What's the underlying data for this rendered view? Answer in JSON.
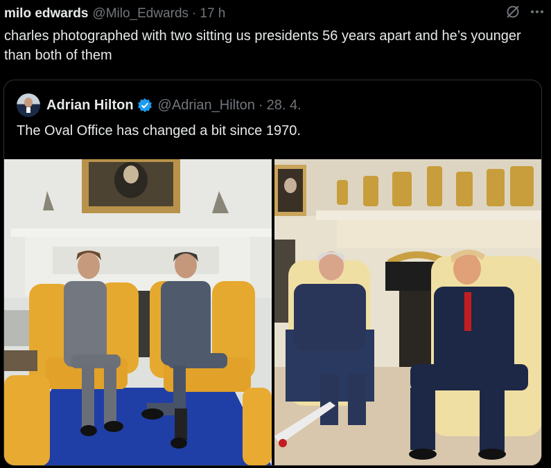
{
  "tweet": {
    "author_name": "milo edwards",
    "author_handle": "@Milo_Edwards",
    "separator": "·",
    "time": "17 h",
    "text": "charles photographed with two sitting us presidents 56 years apart and he’s younger than both of them"
  },
  "quote": {
    "author_name": "Adrian Hilton",
    "author_handle": "@Adrian_Hilton",
    "separator": "·",
    "date": "28. 4.",
    "text": "The Oval Office has changed a bit since 1970."
  },
  "icons": {
    "grok": "grok-icon",
    "more": "more-icon",
    "verified": "verified-badge-icon"
  },
  "colors": {
    "background": "#000000",
    "text": "#e7e9ea",
    "secondary_text": "#71767b",
    "border": "#2f3336",
    "verified_blue": "#1d9bf0"
  }
}
